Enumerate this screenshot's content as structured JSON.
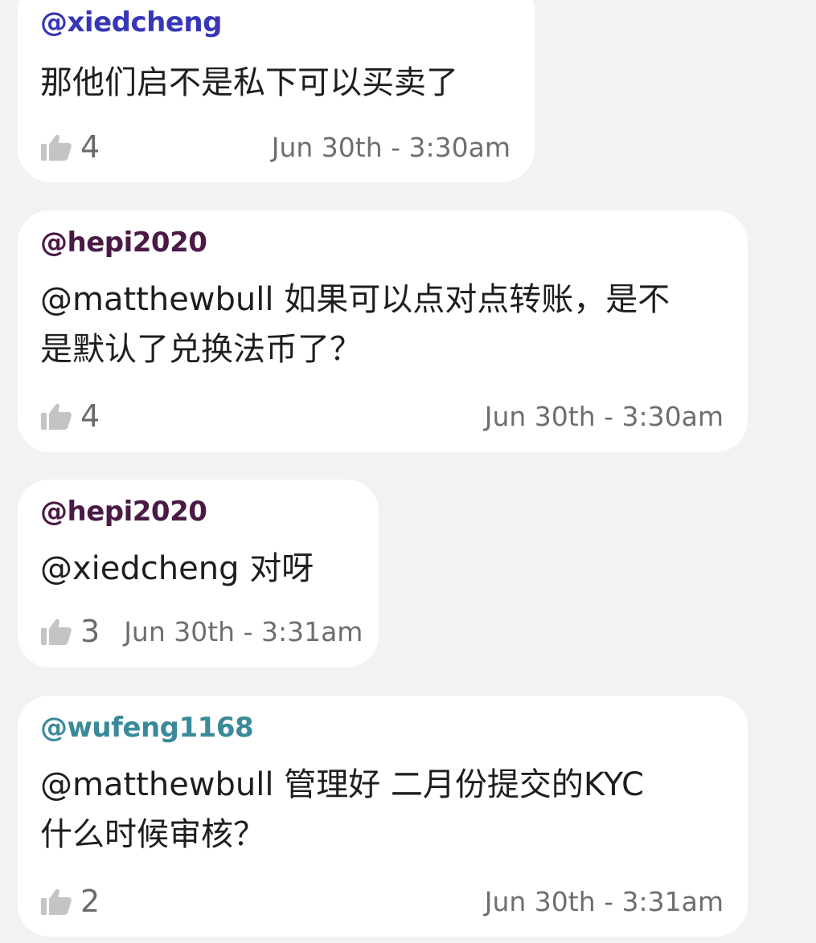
{
  "comments": [
    {
      "username": "@xiedcheng",
      "username_color": "#3636b8",
      "text": "那他们启不是私下可以买卖了",
      "likes": "4",
      "timestamp": "Jun 30th - 3:30am"
    },
    {
      "username": "@hepi2020",
      "username_color": "#4a1a45",
      "text": "@matthewbull 如果可以点对点转账，是不\n是默认了兑换法币了？",
      "likes": "4",
      "timestamp": "Jun 30th - 3:30am"
    },
    {
      "username": "@hepi2020",
      "username_color": "#4a1a45",
      "text": "@xiedcheng 对呀",
      "likes": "3",
      "timestamp": "Jun 30th - 3:31am"
    },
    {
      "username": "@wufeng1168",
      "username_color": "#3a8a99",
      "text": "@matthewbull 管理好 二月份提交的KYC\n什么时候审核？",
      "likes": "2",
      "timestamp": "Jun 30th - 3:31am"
    }
  ],
  "icons": {
    "like": "thumbs-up-icon"
  },
  "colors": {
    "background": "#f2f2f2",
    "bubble": "#ffffff",
    "meta_text": "#6e6e6e"
  }
}
